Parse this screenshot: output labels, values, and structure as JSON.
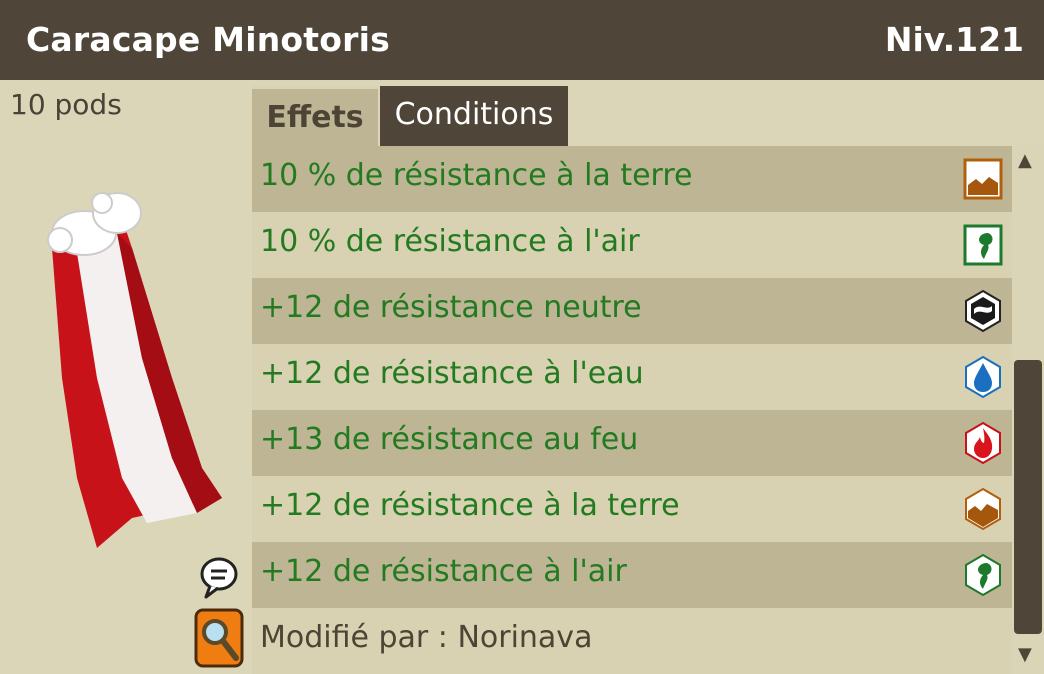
{
  "item": {
    "name": "Caracape Minotoris",
    "level": "Niv.121",
    "weight": "10 pods"
  },
  "tabs": {
    "effects": "Effets",
    "conditions": "Conditions"
  },
  "effects": [
    {
      "text": "10 % de résistance à la terre",
      "icon": "earth-percent-icon"
    },
    {
      "text": "10 % de résistance à l'air",
      "icon": "air-percent-icon"
    },
    {
      "text": "+12 de résistance neutre",
      "icon": "neutral-icon"
    },
    {
      "text": "+12 de résistance à l'eau",
      "icon": "water-icon"
    },
    {
      "text": "+13 de résistance au feu",
      "icon": "fire-icon"
    },
    {
      "text": "+12 de résistance à la terre",
      "icon": "earth-icon"
    },
    {
      "text": "+12 de résistance à l'air",
      "icon": "air-icon"
    }
  ],
  "modified_by": "Modifié par : Norinava",
  "colors": {
    "header": "#4f4639",
    "effect_text": "#237a20",
    "row_dark": "#bdb594",
    "row_light": "#d8d2b2"
  }
}
